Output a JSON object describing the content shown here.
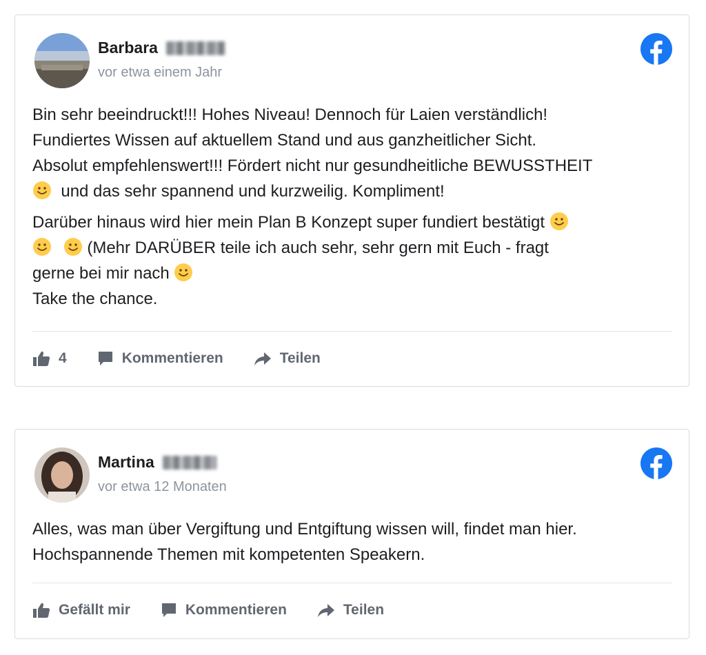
{
  "posts": [
    {
      "author_first": "Barbara",
      "timestamp": "vor etwa einem Jahr",
      "paragraph1": [
        "Bin sehr beeindruckt!!! Hohes Niveau! Dennoch für Laien verständlich!",
        "Fundiertes Wissen auf aktuellem Stand und aus ganzheitlicher Sicht.",
        "Absolut empfehlenswert!!! Fördert nicht nur gesundheitliche BEWUSSTHEIT",
        "und das sehr spannend und kurzweilig. Kompliment!"
      ],
      "paragraph2": [
        "Darüber hinaus wird hier mein Plan B Konzept super fundiert bestätigt",
        "(Mehr DARÜBER teile ich auch sehr, sehr gern mit Euch - fragt",
        "gerne bei mir nach",
        "Take the chance."
      ],
      "like_label": "4",
      "comment_label": "Kommentieren",
      "share_label": "Teilen"
    },
    {
      "author_first": "Martina",
      "timestamp": "vor etwa 12 Monaten",
      "paragraph1": [
        "Alles, was man über Vergiftung und Entgiftung wissen will, findet man hier.",
        "Hochspannende Themen mit kompetenten Speakern."
      ],
      "like_label": "Gefällt mir",
      "comment_label": "Kommentieren",
      "share_label": "Teilen"
    }
  ],
  "colors": {
    "facebook_blue": "#1877f2",
    "action_gray": "#606770",
    "timestamp_gray": "#8d949e",
    "emoji_yellow": "#ffcc4d"
  },
  "icons": [
    "facebook-logo-icon",
    "like-icon",
    "comment-icon",
    "share-icon",
    "smiley-emoji-icon"
  ]
}
